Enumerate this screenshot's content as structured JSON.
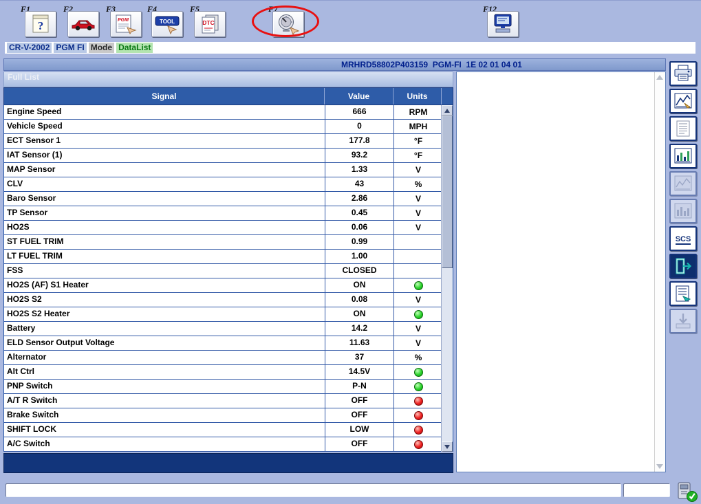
{
  "colors": {
    "window_background": "#aab8e0",
    "accent_navy": "#12357b",
    "table_header_blue": "#2e5ca8",
    "lamp_green": "#2bd32b",
    "lamp_red": "#ee2020",
    "annotation_red": "#e81010",
    "breadcrumb_green": "#b4e4b0"
  },
  "toolbar": {
    "buttons": [
      {
        "fkey": "F1",
        "icon": "help-icon",
        "text": "?"
      },
      {
        "fkey": "F2",
        "icon": "vehicle-icon"
      },
      {
        "fkey": "F3",
        "icon": "pgm-tester-icon",
        "text": "PGM"
      },
      {
        "fkey": "F4",
        "icon": "tool-box-icon",
        "text": "TOOL"
      },
      {
        "fkey": "F5",
        "icon": "dtc-icon",
        "text": "DTC"
      },
      {
        "fkey": "F7",
        "icon": "gauge-datalist-icon",
        "circled": true
      },
      {
        "fkey": "F12",
        "icon": "exit-system-icon"
      }
    ]
  },
  "annotation": {
    "shape": "ellipse",
    "color": "#e81010",
    "target": "F7"
  },
  "breadcrumb": {
    "items": [
      {
        "label": "CR-V-2002",
        "type": "vehicle"
      },
      {
        "label": "PGM FI",
        "type": "system"
      },
      {
        "label": "Mode",
        "type": "mode"
      },
      {
        "label": "DataList",
        "type": "selection"
      }
    ]
  },
  "titlebar": {
    "text": "MRHRD58802P403159  PGM-FI  1E 02 01 04 01"
  },
  "datalist": {
    "section_label": "Full List",
    "columns": [
      "Signal",
      "Value",
      "Units"
    ],
    "rows": [
      {
        "signal": "Engine Speed",
        "value": "666",
        "units": "RPM"
      },
      {
        "signal": "Vehicle Speed",
        "value": "0",
        "units": "MPH"
      },
      {
        "signal": "ECT Sensor 1",
        "value": "177.8",
        "units": "°F"
      },
      {
        "signal": "IAT Sensor (1)",
        "value": "93.2",
        "units": "°F"
      },
      {
        "signal": "MAP Sensor",
        "value": "1.33",
        "units": "V"
      },
      {
        "signal": "CLV",
        "value": "43",
        "units": "%"
      },
      {
        "signal": "Baro Sensor",
        "value": "2.86",
        "units": "V"
      },
      {
        "signal": "TP Sensor",
        "value": "0.45",
        "units": "V"
      },
      {
        "signal": "HO2S",
        "value": "0.06",
        "units": "V"
      },
      {
        "signal": "ST FUEL TRIM",
        "value": "0.99",
        "units": ""
      },
      {
        "signal": "LT FUEL TRIM",
        "value": "1.00",
        "units": ""
      },
      {
        "signal": "FSS",
        "value": "CLOSED",
        "units": ""
      },
      {
        "signal": "HO2S (AF) S1 Heater",
        "value": "ON",
        "units": "",
        "indicator": "green"
      },
      {
        "signal": "HO2S S2",
        "value": "0.08",
        "units": "V"
      },
      {
        "signal": "HO2S S2 Heater",
        "value": "ON",
        "units": "",
        "indicator": "green"
      },
      {
        "signal": "Battery",
        "value": "14.2",
        "units": "V"
      },
      {
        "signal": "ELD Sensor Output Voltage",
        "value": "11.63",
        "units": "V"
      },
      {
        "signal": "Alternator",
        "value": "37",
        "units": "%"
      },
      {
        "signal": "Alt Ctrl",
        "value": "14.5V",
        "units": "",
        "indicator": "green"
      },
      {
        "signal": "PNP Switch",
        "value": "P-N",
        "units": "",
        "indicator": "green"
      },
      {
        "signal": "A/T R Switch",
        "value": "OFF",
        "units": "",
        "indicator": "red"
      },
      {
        "signal": "Brake Switch",
        "value": "OFF",
        "units": "",
        "indicator": "red"
      },
      {
        "signal": "SHIFT LOCK",
        "value": "LOW",
        "units": "",
        "indicator": "red"
      },
      {
        "signal": "A/C Switch",
        "value": "OFF",
        "units": "",
        "indicator": "red"
      }
    ]
  },
  "sidebar": {
    "scs_label": "SCS",
    "buttons": [
      {
        "icon": "print-icon",
        "enabled": true
      },
      {
        "icon": "graph-setup-icon",
        "enabled": true
      },
      {
        "icon": "list-view-icon",
        "enabled": true
      },
      {
        "icon": "meter-view-icon",
        "enabled": true
      },
      {
        "icon": "graph-review-disabled-icon",
        "enabled": false
      },
      {
        "icon": "chart-review-disabled-icon",
        "enabled": false
      },
      {
        "icon": "scs-icon",
        "enabled": true
      },
      {
        "icon": "exit-icon",
        "enabled": true
      },
      {
        "icon": "snapshot-list-icon",
        "enabled": true
      },
      {
        "icon": "page-down-disabled-icon",
        "enabled": false
      }
    ]
  },
  "statusbar": {
    "message": "",
    "aux": ""
  }
}
